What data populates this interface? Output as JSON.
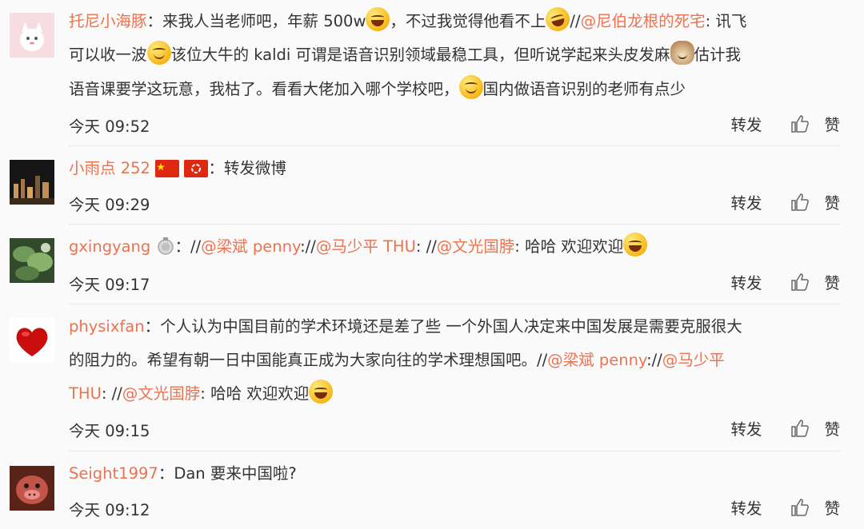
{
  "comments": [
    {
      "name": "托尼小海豚",
      "sep": "：",
      "parts": [
        "来我人当老师吧，年薪 500w",
        "，不过我觉得他看不上",
        "//"
      ],
      "mention1": "@尼伯龙根的死宅",
      "after1": ": 讯飞",
      "line2a": "可以收一波",
      "line2b": "该位大牛的 kaldi 可谓是语音识别领域最稳工具，但听说学起来头皮发麻",
      "line2c": "估计我",
      "line3a": "语音课要学这玩意，我枯了。看看大佬加入哪个学校吧，",
      "line3b": "国内做语音识别的老师有点少",
      "time": "今天 09:52"
    },
    {
      "name": "小雨点 252",
      "sep": "：",
      "text": "转发微博",
      "time": "今天 09:29"
    },
    {
      "name": "gxingyang",
      "sep": "：",
      "pre": "//",
      "m1": "@梁斌 penny",
      "s1": "://",
      "m2": "@马少平 THU",
      "s2": ": //",
      "m3": "@文光国脖",
      "s3": ": 哈哈 欢迎欢迎",
      "time": "今天 09:17"
    },
    {
      "name": "physixfan",
      "sep": "：",
      "line1": "个人认为中国目前的学术环境还是差了些 一个外国人决定来中国发展是需要克服很大",
      "line2a": "的阻力的。希望有朝一日中国能真正成为大家向往的学术理想国吧。//",
      "line2m": "@梁斌 penny",
      "line2s": "://",
      "line2m2": "@马少平",
      "line3m": "THU",
      "line3s": ": //",
      "line3m2": "@文光国脖",
      "line3t": ": 哈哈 欢迎欢迎",
      "time": "今天 09:15"
    },
    {
      "name": "Seight1997",
      "sep": "：",
      "text": "Dan 要来中国啦?",
      "time": "今天 09:12"
    }
  ],
  "actions": {
    "repost": "转发",
    "like": "赞"
  },
  "icons": [
    "laughing-emoji",
    "smile-emoji",
    "cat-emoji",
    "thumbs-up-icon",
    "china-flag-icon",
    "hongkong-flag-icon",
    "medal-icon"
  ]
}
